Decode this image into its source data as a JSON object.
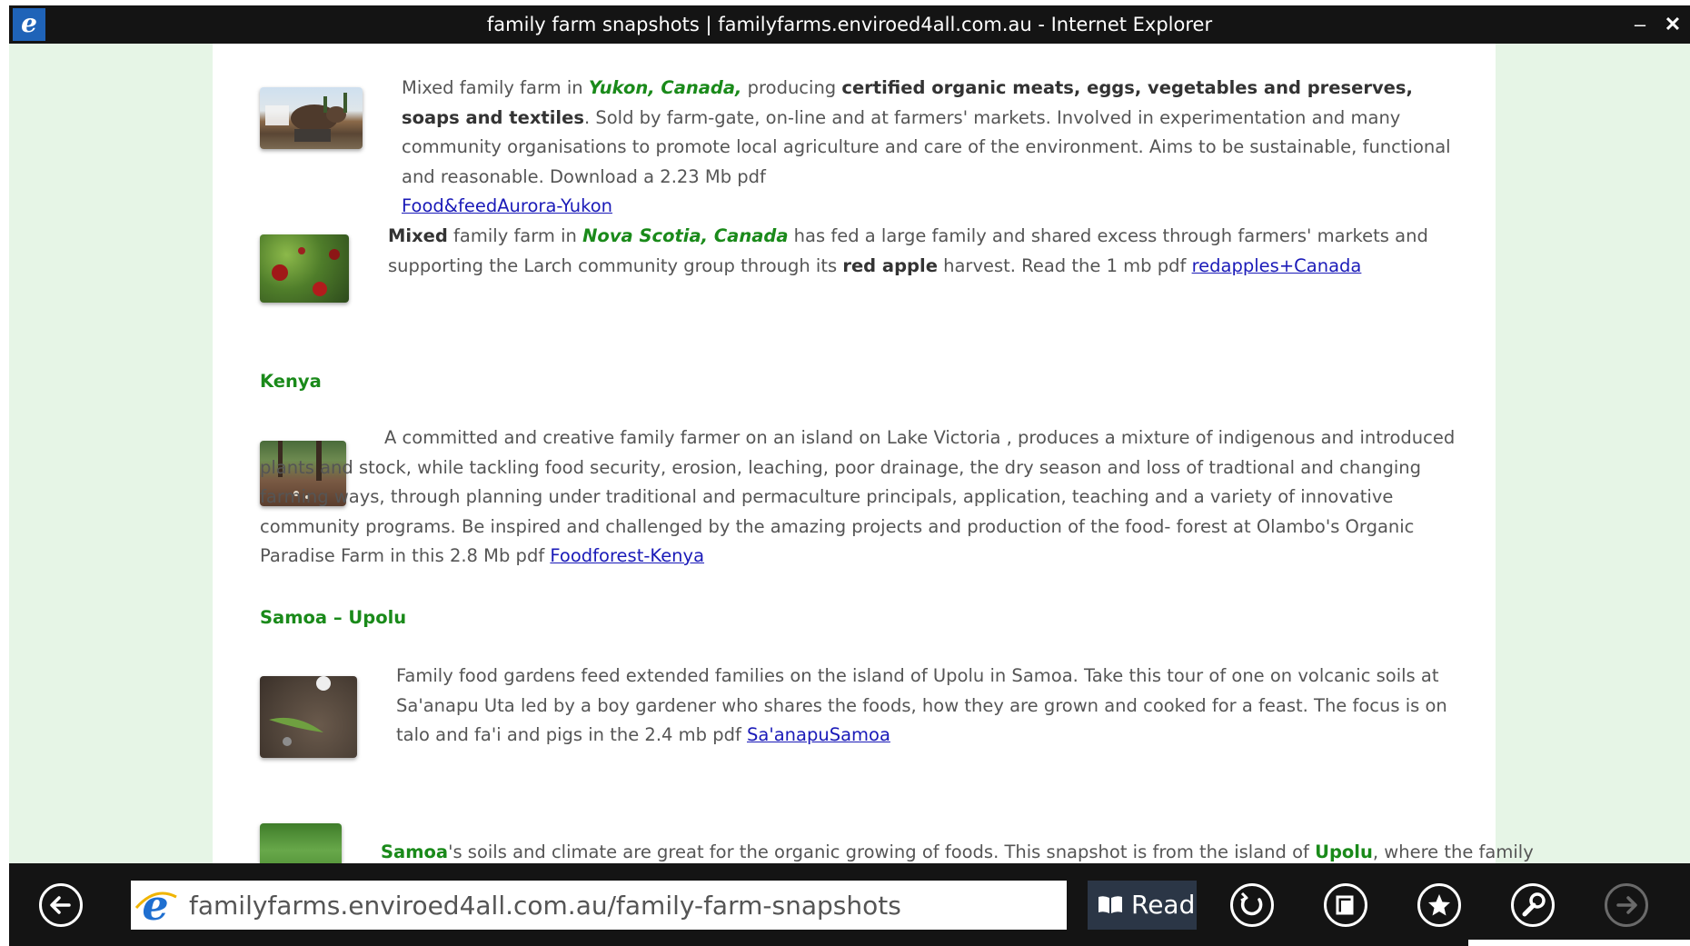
{
  "window": {
    "title": "family farm snapshots | familyfarms.enviroed4all.com.au - Internet Explorer",
    "icon_letter": "e",
    "minimize_glyph": "–",
    "close_glyph": "✕"
  },
  "entries": [
    {
      "image": "pig-farm-photo",
      "pre": "Mixed family farm in ",
      "region": "Yukon, Canada,",
      "mid1": " producing ",
      "products": "certified organic meats, eggs, vegetables and preserves, soaps and textiles",
      "rest": ". Sold by farm-gate, on-line and at farmers' markets. Involved in experimentation and many community organisations to promote local agriculture and care of the environment. Aims to be sustainable, functional and reasonable. Download a 2.23 Mb pdf ",
      "link": "Food&feedAurora-Yukon"
    },
    {
      "image": "red-apples-photo",
      "lead": "Mixed",
      "pre": " family farm in ",
      "region": "Nova Scotia, Canada",
      "mid1": " has fed a large family and shared excess through farmers' markets and supporting the Larch community group through its ",
      "bold2": "red apple",
      "rest": " harvest. Read the 1 mb pdf ",
      "link": "redapples+Canada"
    }
  ],
  "headings": {
    "kenya": "Kenya",
    "samoa": "Samoa – Upolu"
  },
  "kenya_entry": {
    "image": "food-forest-photo",
    "text": "A committed and creative family farmer on an island on Lake Victoria , produces a mixture of indigenous and introduced plants and stock, while tackling food security, erosion, leaching, poor drainage, the dry  season and loss of tradtional and changing farming ways, through planning under  traditional and permaculture principals, application, teaching and a variety of innovative community programs.  Be inspired and challenged by the amazing projects and production of the food- forest at Olambo's Organic Paradise Farm in this 2.8 Mb pdf ",
    "link": "Foodforest-Kenya"
  },
  "samoa_entry": {
    "image": "garden-taro-photo",
    "text": "Family food gardens feed extended families on the island of Upolu in Samoa. Take this tour of one on volcanic soils at Sa'anapu Uta led by a boy gardener  who shares the foods, how they are grown and cooked for a feast. The focus is on talo and fa'i  and pigs in the 2.4 mb pdf ",
    "link": "Sa'anapuSamoa"
  },
  "samoa_entry2": {
    "image": "green-garden-photo",
    "lead": "Samoa",
    "mid": "'s soils and climate are great for the organic growing of foods. This snapshot is from the island of ",
    "place": "Upolu",
    "rest": ", where the family"
  },
  "appbar": {
    "url_domain_prefix": "familyfarms.",
    "url_domain_main": "enviroed4all.com.au",
    "url_path": "/family-farm-snapshots",
    "url": "familyfarms.enviroed4all.com.au/family-farm-snapshots",
    "read_label": "Read",
    "icons": [
      "back-icon",
      "ie-icon",
      "reading-book-icon",
      "refresh-icon",
      "tabs-icon",
      "favorites-star-icon",
      "tools-wrench-icon",
      "forward-icon"
    ]
  },
  "colors": {
    "title_bar": "#141414",
    "page_margin": "#e6f5e6",
    "heading_green": "#1a8a1a",
    "link_blue": "#1a1ab8",
    "read_button": "#2b3646"
  }
}
